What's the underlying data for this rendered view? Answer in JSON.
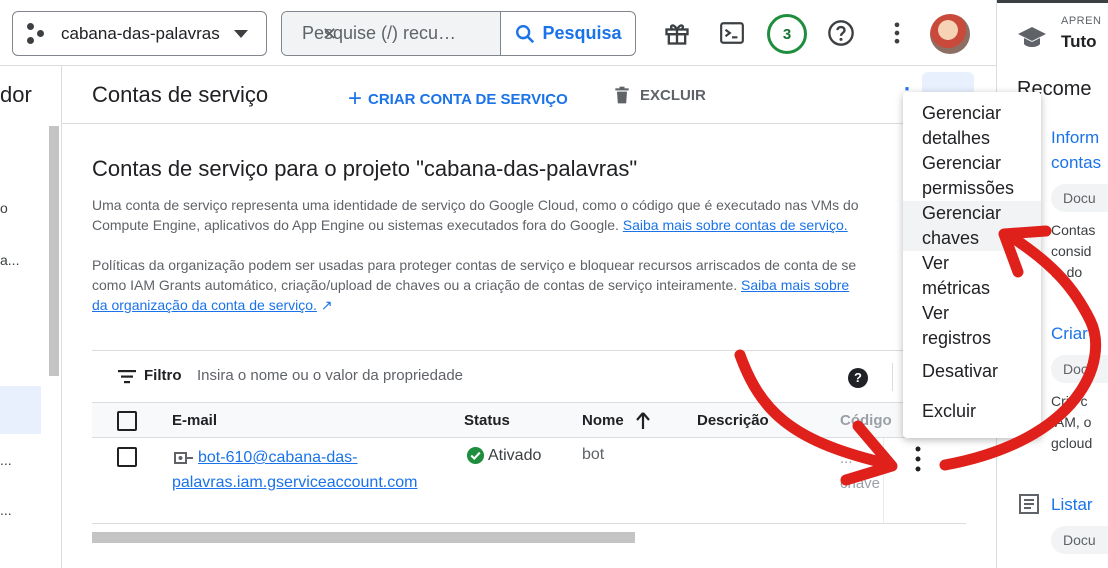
{
  "topbar": {
    "project": "cabana-das-palavras",
    "search_placeholder": "Pesquise (/) recu…",
    "search_button": "Pesquisa",
    "notification_count": "3",
    "icons": [
      "gift-icon",
      "terminal-icon",
      "help-icon",
      "more-vert-icon",
      "avatar"
    ]
  },
  "leftnav": {
    "title_fragment": "dor",
    "fragments": [
      "o",
      "a...",
      "...",
      "..."
    ]
  },
  "header": {
    "title": "Contas de serviço",
    "create_label": "CRIAR CONTA DE SERVIÇO",
    "delete_label": "EXCLUIR"
  },
  "main": {
    "heading": "Contas de serviço para o projeto \"cabana-das-palavras\"",
    "para1_line1": "Uma conta de serviço representa uma identidade de serviço do Google Cloud, como o código que é executado nas VMs do",
    "para1_line2_text": "Compute Engine, aplicativos do App Engine ou sistemas executados fora do Google.",
    "para1_link": "Saiba mais sobre contas de serviço.",
    "para2_line1": "Políticas da organização podem ser usadas para proteger contas de serviço e bloquear recursos arriscados de conta de se",
    "para2_line2_text": "como IAM Grants automático, criação/upload de chaves ou a criação de contas de serviço inteiramente.",
    "para2_link1": "Saiba mais sobre",
    "para2_link2": "da organização da conta de serviço."
  },
  "filter": {
    "label": "Filtro",
    "placeholder": "Insira o nome ou o valor da propriedade"
  },
  "table": {
    "columns": [
      "E-mail",
      "Status",
      "Nome",
      "Descrição",
      "Código"
    ],
    "rows": [
      {
        "email_line1": "bot-610@cabana-das-",
        "email_line2": "palavras.iam.gserviceaccount.com",
        "status": "Ativado",
        "nome": "bot",
        "code_line1": "...",
        "code_line2": "chave"
      }
    ]
  },
  "menu": {
    "items": [
      {
        "l1": "Gerenciar",
        "l2": "detalhes"
      },
      {
        "l1": "Gerenciar",
        "l2": "permissões"
      },
      {
        "l1": "Gerenciar",
        "l2": "chaves"
      },
      {
        "l1": "Ver",
        "l2": "métricas"
      },
      {
        "l1": "Ver",
        "l2": "registros"
      },
      {
        "l1": "Desativar",
        "l2": ""
      },
      {
        "l1": "Excluir",
        "l2": ""
      }
    ]
  },
  "rightpanel": {
    "caption": "APREN",
    "title": "Tuto",
    "heading": "Recome",
    "link1_l1": "Inform",
    "link1_l2": "contas",
    "chip1": "Docu",
    "text1_l1": "Contas",
    "text1_l2": "consid",
    "text1_l3": "ta do",
    "link2": "Criar",
    "chip2": "Docu",
    "text2_l1": "Crie c",
    "text2_l2": "IAM, o",
    "text2_l3": "gcloud",
    "link3": "Listar",
    "chip3": "Docu"
  },
  "colors": {
    "accent": "#1a73e8",
    "annotation": "#e0201b",
    "status_ok": "#1e8e3e"
  }
}
